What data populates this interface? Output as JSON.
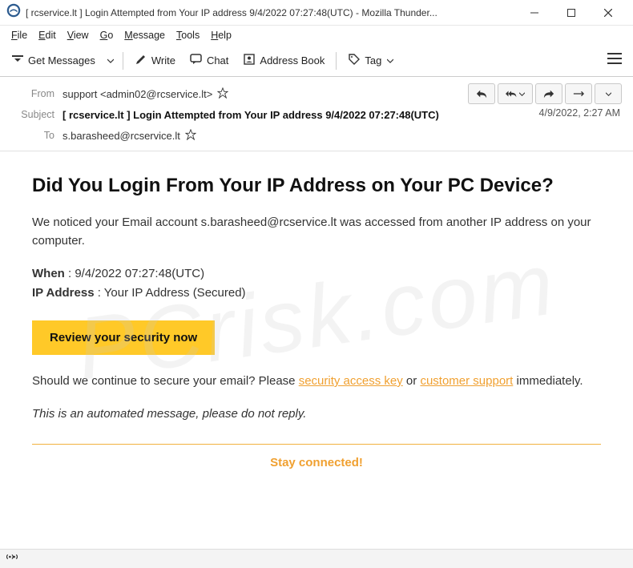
{
  "window": {
    "title": "[ rcservice.lt ] Login Attempted from Your IP address 9/4/2022 07:27:48(UTC) - Mozilla Thunder..."
  },
  "menu": {
    "file": "File",
    "edit": "Edit",
    "view": "View",
    "go": "Go",
    "message": "Message",
    "tools": "Tools",
    "help": "Help"
  },
  "toolbar": {
    "get_messages": "Get Messages",
    "write": "Write",
    "chat": "Chat",
    "address_book": "Address Book",
    "tag": "Tag"
  },
  "headers": {
    "from_label": "From",
    "from_value": "support <admin02@rcservice.lt>",
    "subject_label": "Subject",
    "subject_value": "[ rcservice.lt ] Login Attempted from Your IP address 9/4/2022 07:27:48(UTC)",
    "to_label": "To",
    "to_value": "s.barasheed@rcservice.lt",
    "date": "4/9/2022, 2:27 AM"
  },
  "body": {
    "heading": "Did You Login From Your IP Address on Your PC Device?",
    "intro": "We noticed your Email account s.barasheed@rcservice.lt was accessed from another IP address on your computer.",
    "when_key": "When",
    "when_val": " : 9/4/2022 07:27:48(UTC)",
    "ip_key": "IP Address",
    "ip_val": " : Your IP Address (Secured)",
    "review_btn": "Review your security now",
    "q1": "Should we continue to secure your email? Please ",
    "link1": "security access key",
    "or": "  or ",
    "link2": " customer support",
    "q2": " immediately.",
    "auto": "This is an automated message, please do not reply.",
    "stay": "Stay connected!"
  },
  "watermark": "PCrisk.com"
}
